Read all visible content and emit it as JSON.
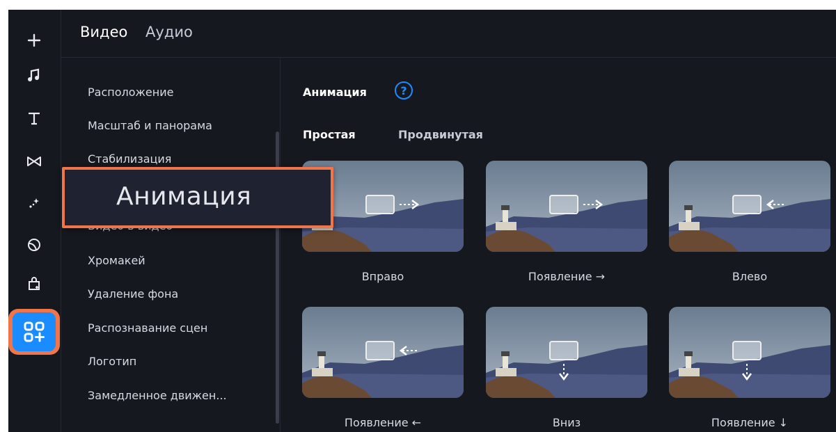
{
  "rail": {
    "items": [
      {
        "icon": "plus-icon"
      },
      {
        "icon": "music-note-icon"
      },
      {
        "icon": "text-icon"
      },
      {
        "icon": "transitions-icon"
      },
      {
        "icon": "magic-wand-icon"
      },
      {
        "icon": "stickers-icon"
      },
      {
        "icon": "store-bag-icon"
      },
      {
        "icon": "more-tools-icon"
      }
    ],
    "active_color": "#1a8cff",
    "highlight_color": "#f0764a"
  },
  "tabs": {
    "video": "Видео",
    "audio": "Аудио"
  },
  "settings_list": [
    "Расположение",
    "Масштаб и панорама",
    "Стабилизация",
    "Видео в видео",
    "Хромакей",
    "Удаление фона",
    "Распознавание сцен",
    "Логотип",
    "Замедленное движен..."
  ],
  "panel": {
    "title": "Анимация",
    "help": "?",
    "subtabs": {
      "simple": "Простая",
      "advanced": "Продвинутая"
    }
  },
  "animations": [
    {
      "label": "Вправо",
      "arrow": "right-arrow-icon"
    },
    {
      "label": "Появление →",
      "arrow": "right-arrow-icon"
    },
    {
      "label": "Влево",
      "arrow": "left-arrow-icon"
    },
    {
      "label": "Появление ←",
      "arrow": "left-arrow-icon"
    },
    {
      "label": "Вниз",
      "arrow": "down-arrow-icon"
    },
    {
      "label": "Появление ↓",
      "arrow": "down-arrow-icon"
    }
  ],
  "callout": {
    "text": "Анимация"
  }
}
